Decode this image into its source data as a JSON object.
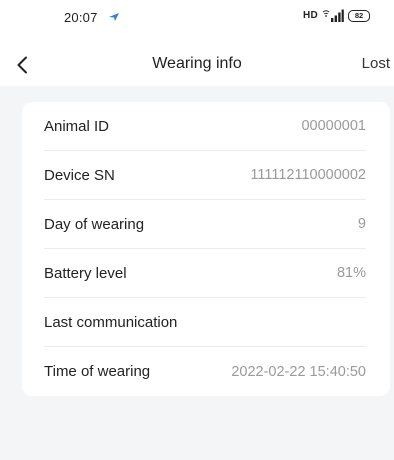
{
  "status_bar": {
    "time": "20:07",
    "network_label": "HD",
    "battery_level": "82",
    "app_icon": "location-arrow-icon",
    "signal_icon": "cellular-signal-icon"
  },
  "nav": {
    "back_icon": "chevron-left-icon",
    "title": "Wearing info",
    "action_label": "Lost"
  },
  "info": {
    "rows": [
      {
        "label": "Animal ID",
        "value": "00000001"
      },
      {
        "label": "Device SN",
        "value": "111112110000002"
      },
      {
        "label": "Day of wearing",
        "value": "9"
      },
      {
        "label": "Battery level",
        "value": "81%"
      },
      {
        "label": "Last communication",
        "value": ""
      },
      {
        "label": "Time of wearing",
        "value": "2022-02-22 15:40:50"
      }
    ]
  },
  "colors": {
    "background": "#f4f5f7",
    "card": "#ffffff",
    "label": "#222222",
    "value": "#9a9a9a"
  }
}
